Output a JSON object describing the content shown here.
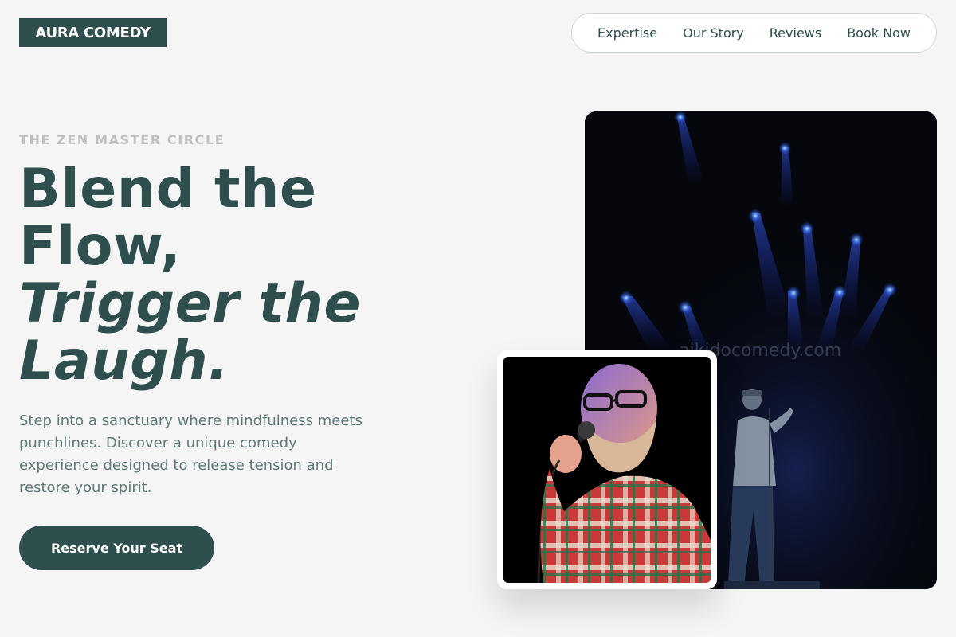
{
  "brand": {
    "logo_text": "AURA COMEDY"
  },
  "nav": {
    "items": [
      {
        "label": "Expertise"
      },
      {
        "label": "Our Story"
      },
      {
        "label": "Reviews"
      },
      {
        "label": "Book Now"
      }
    ]
  },
  "hero": {
    "eyebrow": "THE ZEN MASTER CIRCLE",
    "headline_line1": "Blend the",
    "headline_line2": "Flow,",
    "headline_line3": "Trigger the",
    "headline_line4": "Laugh.",
    "description": "Step into a sanctuary where mindfulness meets punchlines. Discover a unique comedy experience designed to release tension and restore your spirit.",
    "cta_label": "Reserve Your Seat"
  },
  "images": {
    "large_photo": {
      "subject": "comedian on stage under blue spotlights",
      "watermark": "aikidocomedy.com"
    },
    "small_photo": {
      "subject": "bearded comedian in plaid shirt holding microphone"
    }
  },
  "colors": {
    "primary": "#2f4f4f",
    "background": "#f5f5f5",
    "eyebrow": "#bfbfbf",
    "body_text": "#5f7878"
  }
}
